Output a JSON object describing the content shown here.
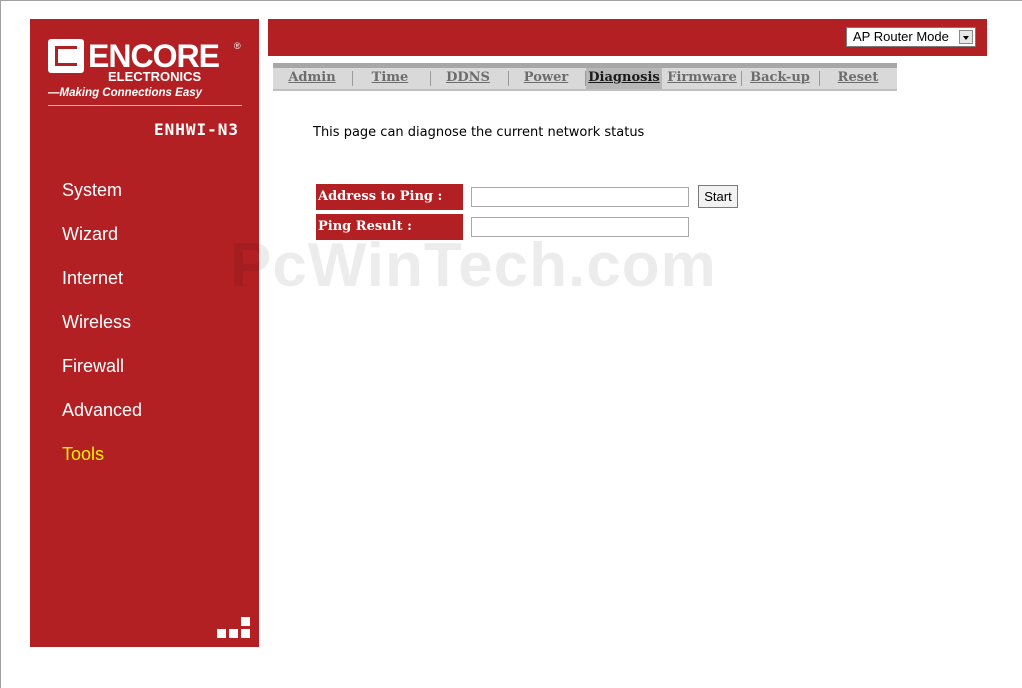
{
  "brand": {
    "name": "ENCORE",
    "sub": "ELECTRONICS",
    "tagline": "Making Connections Easy",
    "reg_mark": "®"
  },
  "model": "ENHWI-N3",
  "sidebar": {
    "items": [
      {
        "label": "System"
      },
      {
        "label": "Wizard"
      },
      {
        "label": "Internet"
      },
      {
        "label": "Wireless"
      },
      {
        "label": "Firewall"
      },
      {
        "label": "Advanced"
      },
      {
        "label": "Tools",
        "active": true
      }
    ]
  },
  "mode_select": {
    "value": "AP Router Mode"
  },
  "tabs": [
    {
      "label": "Admin"
    },
    {
      "label": "Time"
    },
    {
      "label": "DDNS"
    },
    {
      "label": "Power"
    },
    {
      "label": "Diagnosis",
      "active": true
    },
    {
      "label": "Firmware"
    },
    {
      "label": "Back-up"
    },
    {
      "label": "Reset"
    }
  ],
  "main": {
    "intro": "This page can diagnose the current network status",
    "ping_address": {
      "label": "Address to Ping :",
      "value": ""
    },
    "ping_result": {
      "label": "Ping Result :",
      "value": ""
    },
    "start_label": "Start"
  },
  "watermark": "PcWinTech.com",
  "colors": {
    "brand_red": "#b22024",
    "active_nav": "#f8f000",
    "tab_bar": "#d9d9d9"
  }
}
